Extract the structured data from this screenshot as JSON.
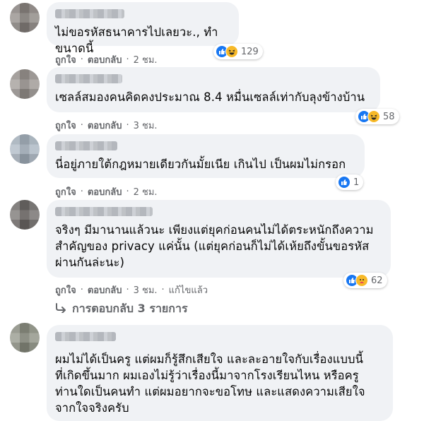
{
  "comments": [
    {
      "text": "ไม่ขอรหัสธนาคารไปเลยวะ., ทำขนาดนี้",
      "actions": {
        "like": "ถูกใจ",
        "reply": "ตอบกลับ",
        "time": "2 ชม."
      },
      "reactions": {
        "icons": [
          "like-icon",
          "haha-icon"
        ],
        "count": "129"
      },
      "avatar_color": "#8a8480"
    },
    {
      "text": "เซลล์สมองคนคิดคงประมาณ 8.4 หมื่นเซลล์เท่ากับลุงข้างบ้าน",
      "actions": {
        "like": "ถูกใจ",
        "reply": "ตอบกลับ",
        "time": "3 ชม."
      },
      "reactions": {
        "icons": [
          "like-icon",
          "haha-icon"
        ],
        "count": "58"
      },
      "avatar_color": "#9a9490"
    },
    {
      "text": "นี่อยู่ภายใต้กฎหมายเดียวกันมั้ยเนีย เกินไป เป็นผมไม่กรอก",
      "actions": {
        "like": "ถูกใจ",
        "reply": "ตอบกลับ",
        "time": "2 ชม."
      },
      "reactions": {
        "icons": [
          "like-icon"
        ],
        "count": "1"
      },
      "avatar_color": "#a8b4c0"
    },
    {
      "text": "จริงๆ มีมานานแล้วนะ เพียงแต่ยุคก่อนคนไม่ได้ตระหนักถึงความ\nสำคัญของ privacy แค่นั้น (แต่ยุคก่อนก็ไม่ได้เห้ยถึงขั้นขอรหัส\nผ่านกันล่ะนะ)",
      "actions": {
        "like": "ถูกใจ",
        "reply": "ตอบกลับ",
        "time": "3 ชม.",
        "edited": "แก้ไขแล้ว"
      },
      "reactions": {
        "icons": [
          "like-icon",
          "care-icon"
        ],
        "count": "62"
      },
      "avatar_color": "#6e6a68"
    },
    {
      "text": "ผมไม่ได้เป็นครู แต่ผมก็รู้สึกเสียใจ และละอายใจกับเรื่องแบบนี้\nที่เกิดขึ้นมาก ผมเองไม่รู้ว่าเรื่องนี้มาจากโรงเรียนไหน หรือครู\nท่านใดเป็นคนทำ แต่ผมอยากจะขอโทษ และแสดงความเสียใจ\nจากใจจริงครับ",
      "avatar_color": "#8c8f82"
    }
  ],
  "replies_link": "การตอบกลับ 3 รายการ",
  "colors": {
    "bubble": "#f0f2f5",
    "meta": "#65676b",
    "like_blue": "#1877f2",
    "emoji_yellow": "#f7b928"
  }
}
